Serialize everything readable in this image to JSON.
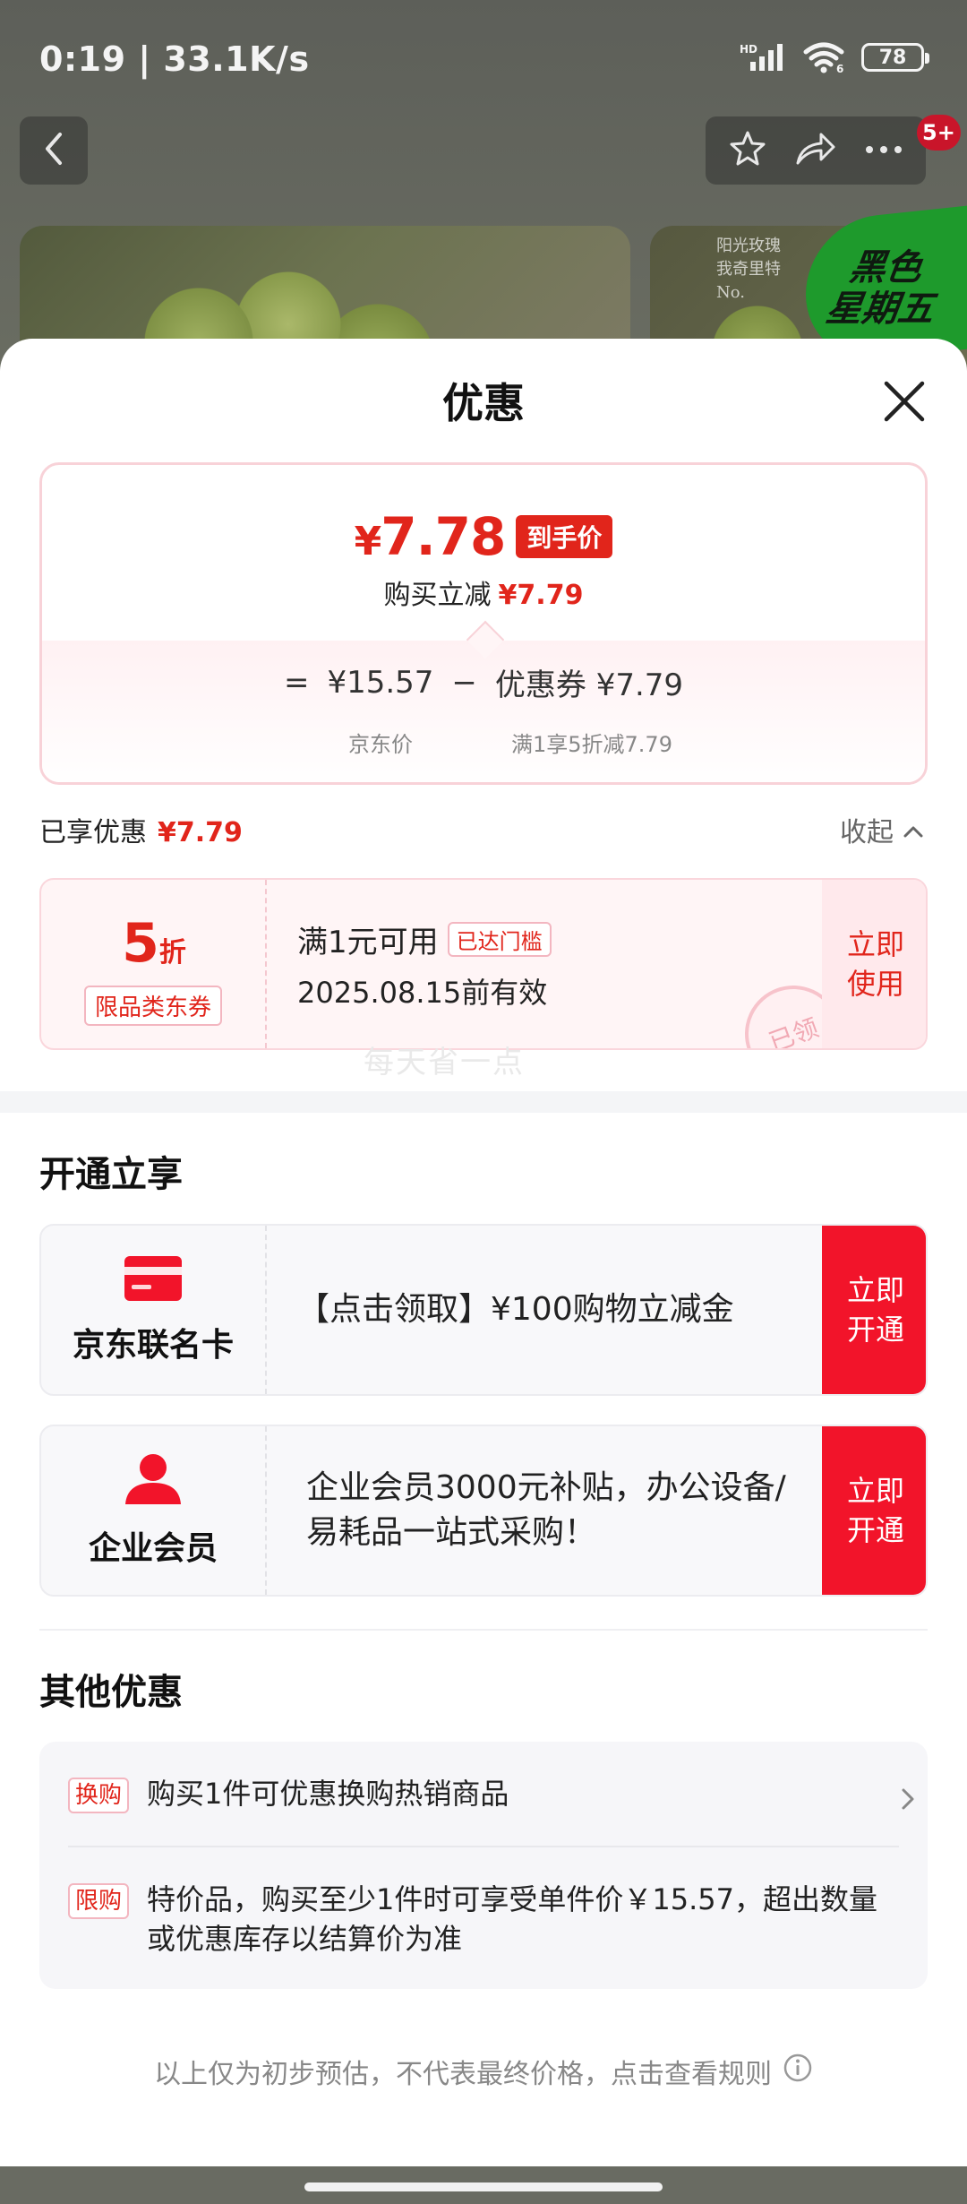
{
  "status_bar": {
    "time": "0:19 | 33.1K/s",
    "signal_label": "HD",
    "wifi_label": "6",
    "battery": "78"
  },
  "nav": {
    "badge": "5+"
  },
  "background": {
    "banner_text": "阳光玫瑰\n我奇里特\nNo.",
    "badge_text": "黑色\n星期五"
  },
  "sheet": {
    "title": "优惠"
  },
  "price_card": {
    "final_price": "7.78",
    "currency": "¥",
    "final_tag": "到手价",
    "sub_label": "购买立减",
    "sub_value": "¥7.79",
    "equals": "=",
    "jd_price": "¥15.57",
    "minus": "−",
    "coupon_label": "优惠券 ¥7.79",
    "jd_price_note": "京东价",
    "coupon_note": "满1享5折减7.79"
  },
  "enjoyed": {
    "label": "已享优惠",
    "value": "¥7.79",
    "collapse_label": "收起"
  },
  "coupon": {
    "discount_num": "5",
    "discount_unit": "折",
    "type": "限品类东券",
    "condition": "满1元可用",
    "reached": "已达门槛",
    "validity": "2025.08.15前有效",
    "use_button": "立即\n使用",
    "stamp": "已领",
    "watermark": "每天省一点"
  },
  "open_section": {
    "title": "开通立享",
    "cards": [
      {
        "name": "京东联名卡",
        "desc": "【点击领取】¥100购物立减金",
        "button": "立即\n开通",
        "icon": "credit-card-icon"
      },
      {
        "name": "企业会员",
        "desc": "企业会员3000元补贴，办公设备/易耗品一站式采购！",
        "button": "立即\n开通",
        "icon": "person-icon"
      }
    ]
  },
  "other_section": {
    "title": "其他优惠",
    "items": [
      {
        "tag": "换购",
        "text": "购买1件可优惠换购热销商品"
      },
      {
        "tag": "限购",
        "text": "特价品，购买至少1件时可享受单件价￥15.57，超出数量或优惠库存以结算价为准"
      }
    ]
  },
  "footer": {
    "note": "以上仅为初步预估，不代表最终价格，点击查看规则"
  },
  "colors": {
    "accent_red": "#e1251b",
    "button_red": "#f2142a",
    "badge_green": "#1e9a2c"
  }
}
